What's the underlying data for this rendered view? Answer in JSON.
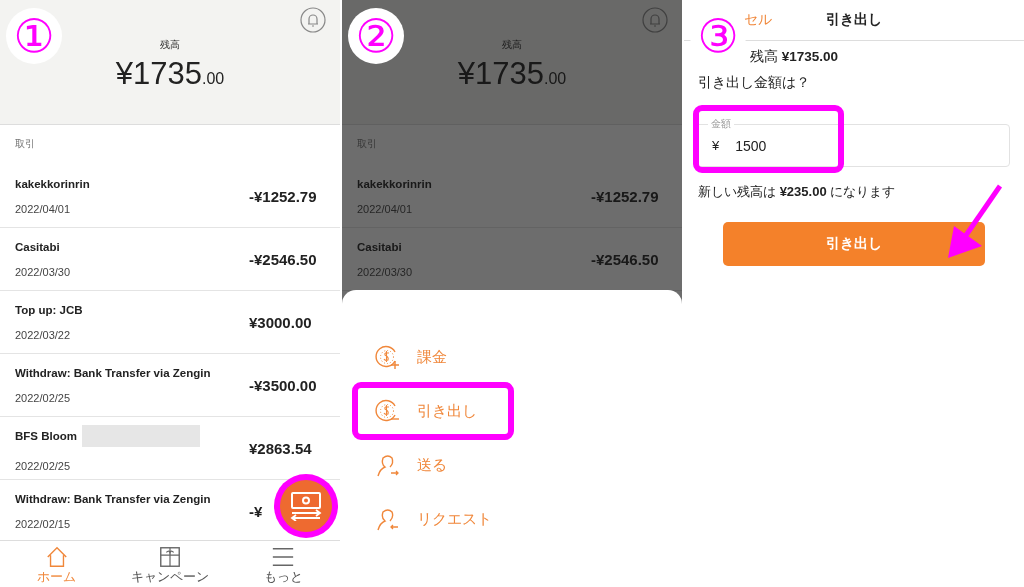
{
  "screen_1": {
    "step_badge": "①",
    "header": {
      "label": "残高",
      "amount": "¥1735",
      "decimals": ".00"
    },
    "section_title": "取引",
    "transactions": [
      {
        "name": "kakekkorinrin",
        "date": "2022/04/01",
        "amount": "-¥1252.79",
        "redacted": false
      },
      {
        "name": "Casitabi",
        "date": "2022/03/30",
        "amount": "-¥2546.50",
        "redacted": false
      },
      {
        "name": "Top up: JCB",
        "date": "2022/03/22",
        "amount": "¥3000.00",
        "redacted": false
      },
      {
        "name": "Withdraw: Bank Transfer via Zengin",
        "date": "2022/02/25",
        "amount": "-¥3500.00",
        "redacted": false
      },
      {
        "name": "BFS Bloom",
        "date": "2022/02/25",
        "amount": "¥2863.54",
        "redacted": true
      },
      {
        "name": "Withdraw: Bank Transfer via Zengin",
        "date": "2022/02/15",
        "amount": "-¥",
        "redacted": false
      }
    ],
    "fab": {
      "highlighted": true
    },
    "bottom_nav": [
      {
        "label": "ホーム",
        "kind": "home",
        "selected": true
      },
      {
        "label": "キャンペーン",
        "kind": "gift",
        "selected": false
      },
      {
        "label": "もっと",
        "kind": "menu",
        "selected": false
      }
    ]
  },
  "screen_2": {
    "step_badge": "②",
    "header": {
      "label": "残高",
      "amount": "¥1735",
      "decimals": ".00"
    },
    "section_title": "取引",
    "transactions": [
      {
        "name": "kakekkorinrin",
        "date": "2022/04/01",
        "amount": "-¥1252.79",
        "redacted": false
      },
      {
        "name": "Casitabi",
        "date": "2022/03/30",
        "amount": "-¥2546.50",
        "redacted": false
      }
    ],
    "sheet_items": [
      {
        "label": "課金",
        "kind": "charge",
        "highlighted": false
      },
      {
        "label": "引き出し",
        "kind": "withdraw",
        "highlighted": true
      },
      {
        "label": "送る",
        "kind": "send",
        "highlighted": false
      },
      {
        "label": "リクエスト",
        "kind": "request",
        "highlighted": false
      }
    ]
  },
  "screen_3": {
    "step_badge": "③",
    "nav": {
      "cancel": "セル",
      "title": "引き出し"
    },
    "balance": "残高 **¥1735.00**",
    "question": "引き出し金額は？",
    "amount_field": {
      "label": "金額",
      "currency": "¥",
      "value": "1500",
      "highlighted": true
    },
    "new_balance": "新しい残高は **¥235.00** になります",
    "button": {
      "label": "引き出し",
      "pointed": true
    }
  }
}
